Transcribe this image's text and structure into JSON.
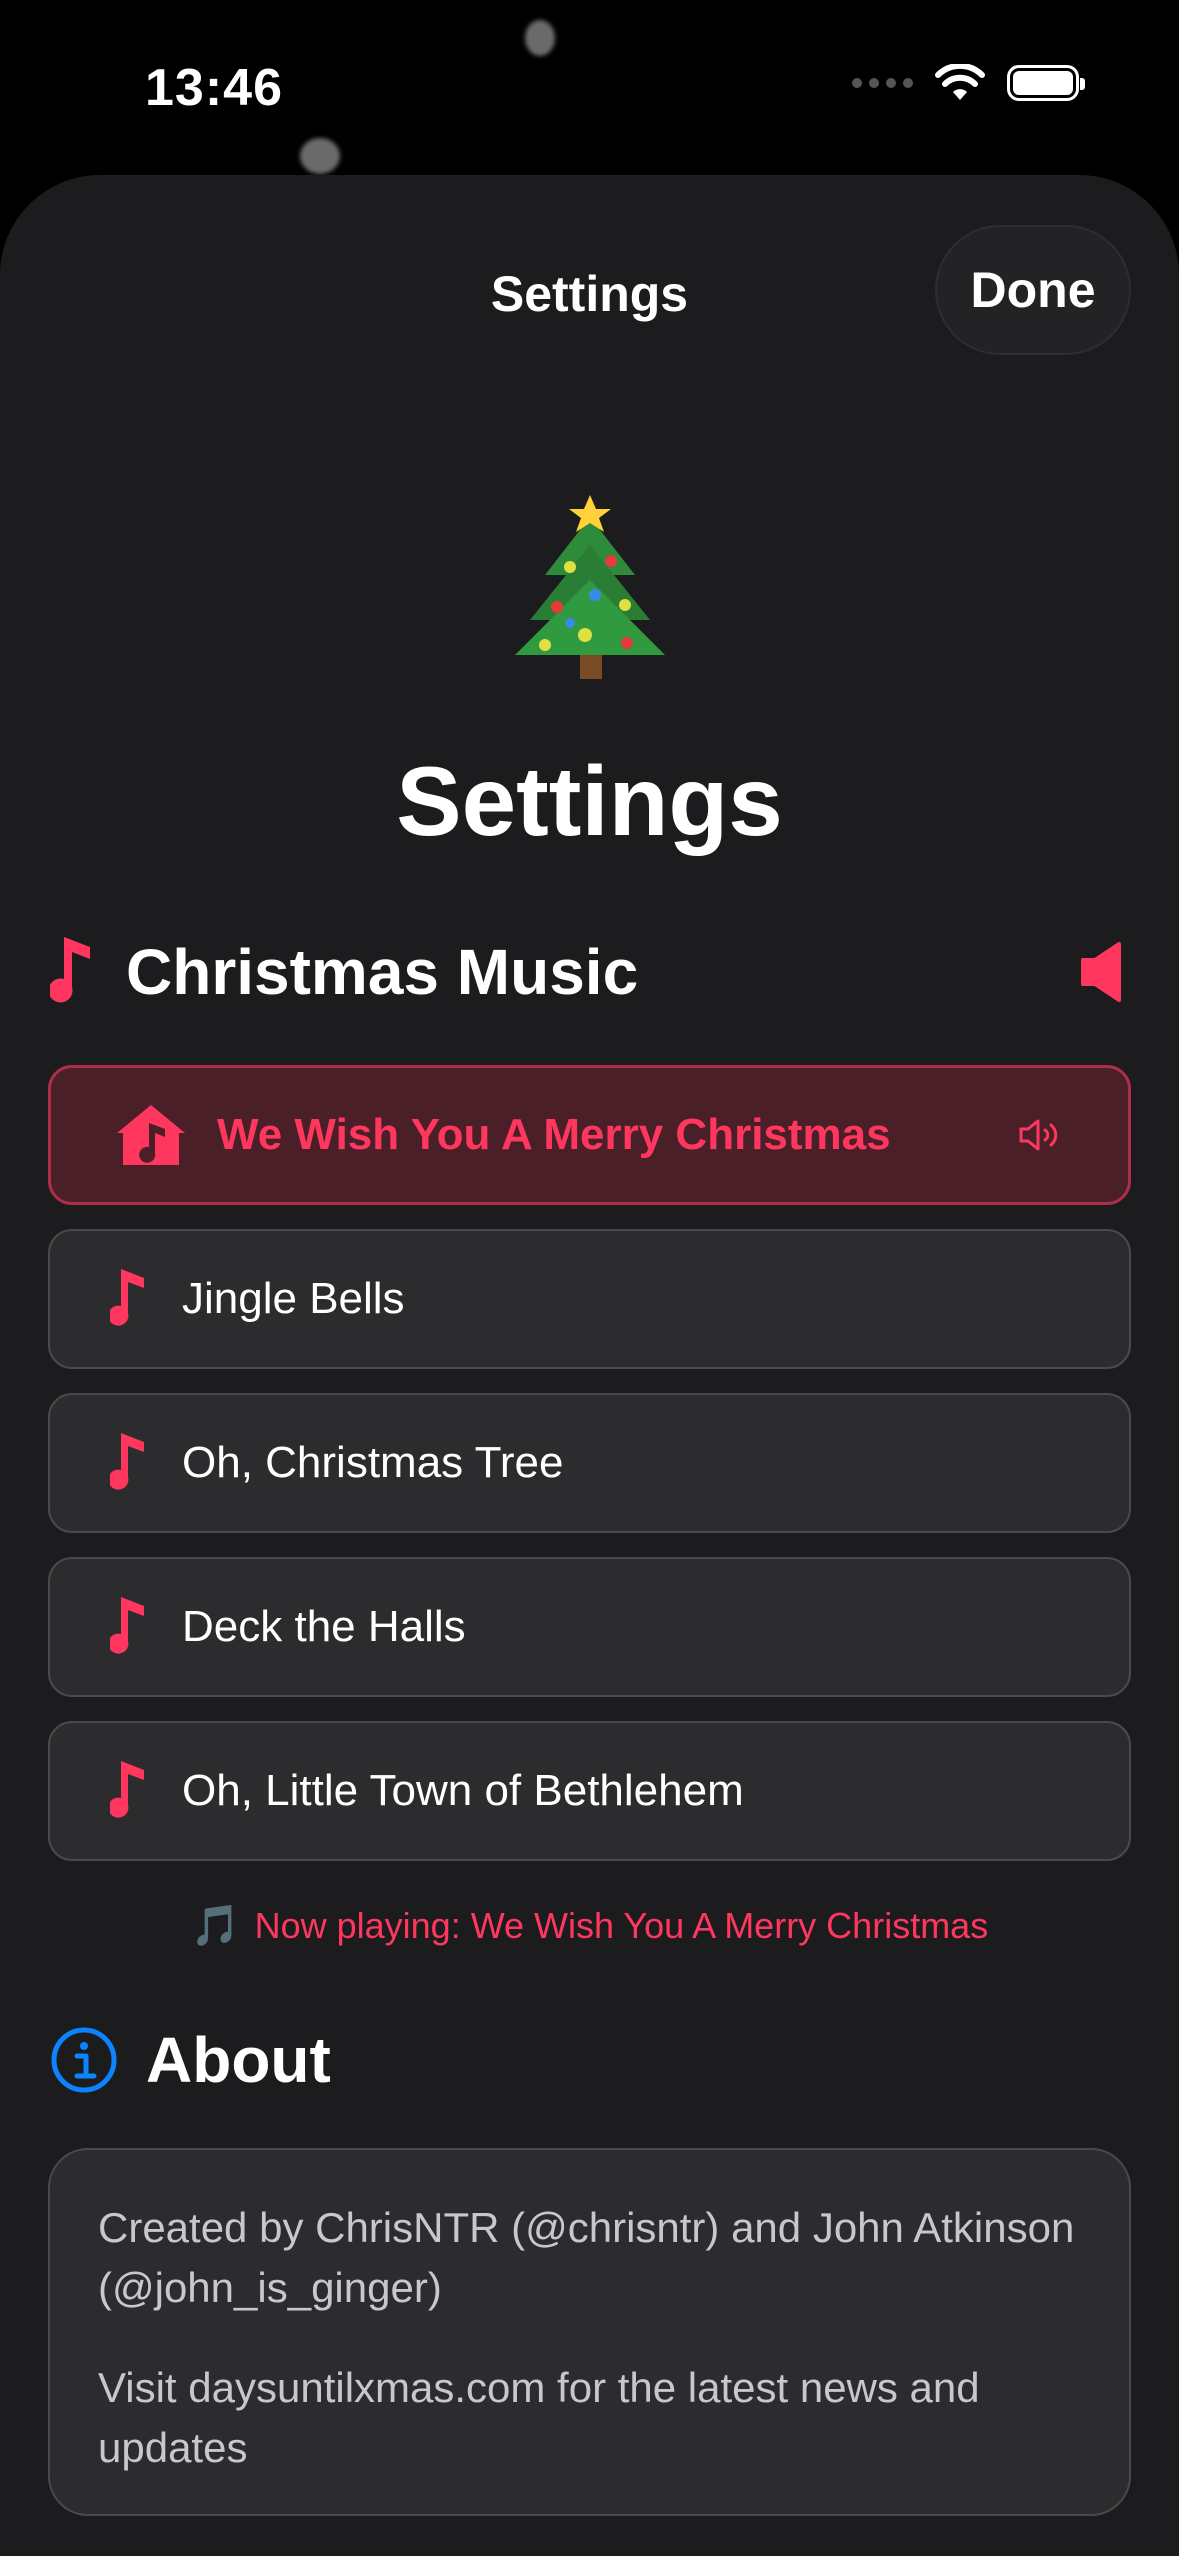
{
  "status_bar": {
    "time": "13:46"
  },
  "nav": {
    "title": "Settings",
    "done_label": "Done"
  },
  "page": {
    "emoji": "🎄",
    "title": "Settings"
  },
  "music_section": {
    "title": "Christmas Music",
    "songs": [
      {
        "label": "We Wish You A Merry Christmas",
        "active": true
      },
      {
        "label": "Jingle Bells",
        "active": false
      },
      {
        "label": "Oh, Christmas Tree",
        "active": false
      },
      {
        "label": "Deck the Halls",
        "active": false
      },
      {
        "label": "Oh, Little Town of Bethlehem",
        "active": false
      }
    ],
    "now_playing_emoji": "🎵",
    "now_playing_text": "Now playing: We Wish You A Merry Christmas"
  },
  "about_section": {
    "title": "About",
    "credits": "Created by ChrisNTR (@chrisntr) and John Atkinson (@john_is_ginger)",
    "visit": "Visit daysuntilxmas.com for the latest news and updates"
  },
  "colors": {
    "accent": "#ff375f",
    "info_blue": "#0a84ff",
    "sheet_background": "#1c1c1e",
    "card_background": "#2c2c2e",
    "active_card_background": "#4a1f28"
  },
  "icons": {
    "music_note": "music-note-icon",
    "speaker": "speaker-icon",
    "home_music": "music-house-icon",
    "sound_wave": "speaker-wave-icon",
    "info": "info-circle-icon"
  }
}
